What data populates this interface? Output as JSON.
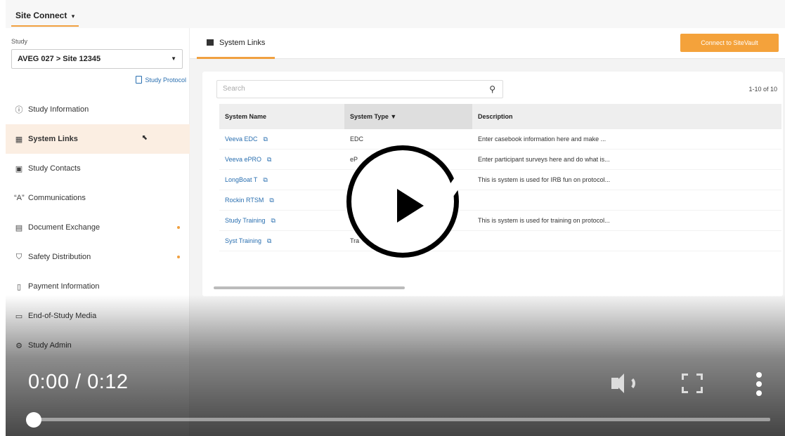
{
  "topbar": {
    "site_connect": "Site Connect",
    "caret": "▾"
  },
  "sidebar": {
    "study_label": "Study",
    "study_value": "AVEG 027 > Site 12345",
    "protocol_link": "Study Protocol",
    "items": [
      {
        "label": "Study Information",
        "icon": "ⓘ",
        "icon_name": "info-icon",
        "active": false,
        "dot": false
      },
      {
        "label": "System Links",
        "icon": "▦",
        "icon_name": "grid-icon",
        "active": true,
        "dot": false
      },
      {
        "label": "Study Contacts",
        "icon": "▣",
        "icon_name": "contacts-icon",
        "active": false,
        "dot": false
      },
      {
        "label": "Communications",
        "icon": "“A”",
        "icon_name": "communications-icon",
        "active": false,
        "dot": false
      },
      {
        "label": "Document Exchange",
        "icon": "▤",
        "icon_name": "document-icon",
        "active": false,
        "dot": true
      },
      {
        "label": "Safety Distribution",
        "icon": "⛉",
        "icon_name": "shield-icon",
        "active": false,
        "dot": true
      },
      {
        "label": "Payment Information",
        "icon": "▯",
        "icon_name": "payment-icon",
        "active": false,
        "dot": false
      },
      {
        "label": "End-of-Study Media",
        "icon": "▭",
        "icon_name": "media-icon",
        "active": false,
        "dot": false
      },
      {
        "label": "Study Admin",
        "icon": "⚙",
        "icon_name": "gear-icon",
        "active": false,
        "dot": false
      }
    ]
  },
  "main": {
    "tab_label": "System Links",
    "connect_button": "Connect to SiteVault",
    "search_placeholder": "Search",
    "count": "1-10 of 10",
    "columns": [
      "System Name",
      "System Type ▼",
      "Description"
    ],
    "rows": [
      {
        "name": "Veeva EDC",
        "type": "EDC",
        "desc": "Enter casebook information here and make ..."
      },
      {
        "name": "Veeva ePRO",
        "type": "eP",
        "desc": "Enter participant surveys here and do what is..."
      },
      {
        "name": "LongBoat T",
        "type": "",
        "desc": "This is system is used for IRB fun on protocol..."
      },
      {
        "name": "Rockin RTSM",
        "type": "",
        "desc": ""
      },
      {
        "name": "Study Training",
        "type": "",
        "desc": "This is system is used for training on protocol..."
      },
      {
        "name": "Syst Training",
        "type": "Tra",
        "desc": ""
      }
    ]
  },
  "player": {
    "time": "0:00 / 0:12",
    "progress": 0,
    "accent": "#f4a23b"
  }
}
